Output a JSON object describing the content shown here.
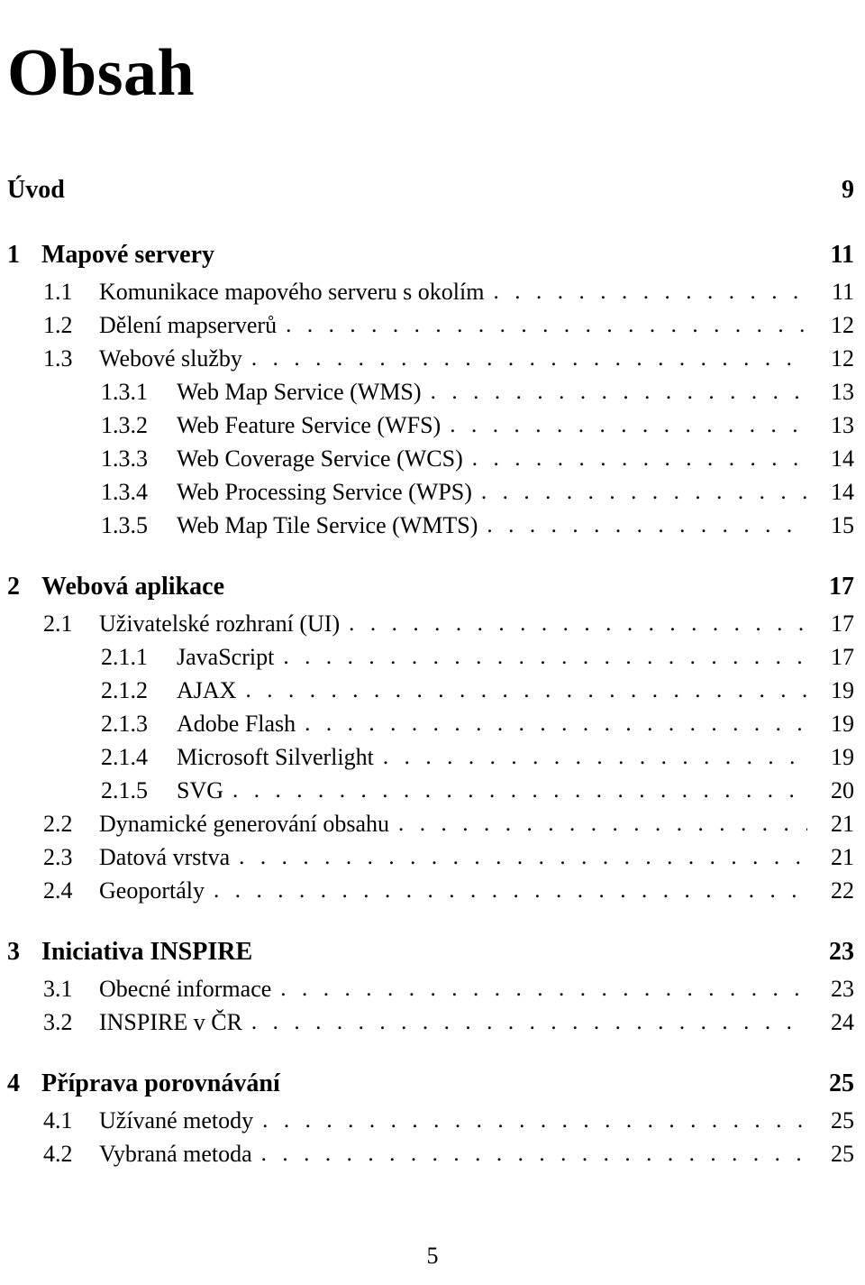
{
  "document": {
    "title": "Obsah",
    "footer_page_number": "5",
    "leader_dot": "."
  },
  "entries": [
    {
      "level": "front",
      "number": "",
      "text": "Úvod",
      "page": "9",
      "gap_before": false
    },
    {
      "level": "chapter",
      "number": "1",
      "text": "Mapové servery",
      "page": "11",
      "gap_before": true
    },
    {
      "level": "section",
      "number": "1.1",
      "text": "Komunikace mapového serveru s okolím",
      "page": "11",
      "gap_before": false
    },
    {
      "level": "section",
      "number": "1.2",
      "text": "Dělení mapserverů",
      "page": "12",
      "gap_before": false
    },
    {
      "level": "section",
      "number": "1.3",
      "text": "Webové služby",
      "page": "12",
      "gap_before": false
    },
    {
      "level": "subsection",
      "number": "1.3.1",
      "text": "Web Map Service (WMS)",
      "page": "13",
      "gap_before": false
    },
    {
      "level": "subsection",
      "number": "1.3.2",
      "text": "Web Feature Service (WFS)",
      "page": "13",
      "gap_before": false
    },
    {
      "level": "subsection",
      "number": "1.3.3",
      "text": "Web Coverage Service (WCS)",
      "page": "14",
      "gap_before": false
    },
    {
      "level": "subsection",
      "number": "1.3.4",
      "text": "Web Processing Service (WPS)",
      "page": "14",
      "gap_before": false
    },
    {
      "level": "subsection",
      "number": "1.3.5",
      "text": "Web Map Tile Service (WMTS)",
      "page": "15",
      "gap_before": false
    },
    {
      "level": "chapter",
      "number": "2",
      "text": "Webová aplikace",
      "page": "17",
      "gap_before": true
    },
    {
      "level": "section",
      "number": "2.1",
      "text": "Uživatelské rozhraní (UI)",
      "page": "17",
      "gap_before": false
    },
    {
      "level": "subsection",
      "number": "2.1.1",
      "text": "JavaScript",
      "page": "17",
      "gap_before": false
    },
    {
      "level": "subsection",
      "number": "2.1.2",
      "text": "AJAX",
      "page": "19",
      "gap_before": false
    },
    {
      "level": "subsection",
      "number": "2.1.3",
      "text": "Adobe Flash",
      "page": "19",
      "gap_before": false
    },
    {
      "level": "subsection",
      "number": "2.1.4",
      "text": "Microsoft Silverlight",
      "page": "19",
      "gap_before": false
    },
    {
      "level": "subsection",
      "number": "2.1.5",
      "text": "SVG",
      "page": "20",
      "gap_before": false
    },
    {
      "level": "section",
      "number": "2.2",
      "text": "Dynamické generování obsahu",
      "page": "21",
      "gap_before": false
    },
    {
      "level": "section",
      "number": "2.3",
      "text": "Datová vrstva",
      "page": "21",
      "gap_before": false
    },
    {
      "level": "section",
      "number": "2.4",
      "text": "Geoportály",
      "page": "22",
      "gap_before": false
    },
    {
      "level": "chapter",
      "number": "3",
      "text": "Iniciativa INSPIRE",
      "page": "23",
      "gap_before": true
    },
    {
      "level": "section",
      "number": "3.1",
      "text": "Obecné informace",
      "page": "23",
      "gap_before": false
    },
    {
      "level": "section",
      "number": "3.2",
      "text": "INSPIRE v ČR",
      "page": "24",
      "gap_before": false
    },
    {
      "level": "chapter",
      "number": "4",
      "text": "Příprava porovnávání",
      "page": "25",
      "gap_before": true
    },
    {
      "level": "section",
      "number": "4.1",
      "text": "Užívané metody",
      "page": "25",
      "gap_before": false
    },
    {
      "level": "section",
      "number": "4.2",
      "text": "Vybraná metoda",
      "page": "25",
      "gap_before": false
    }
  ]
}
